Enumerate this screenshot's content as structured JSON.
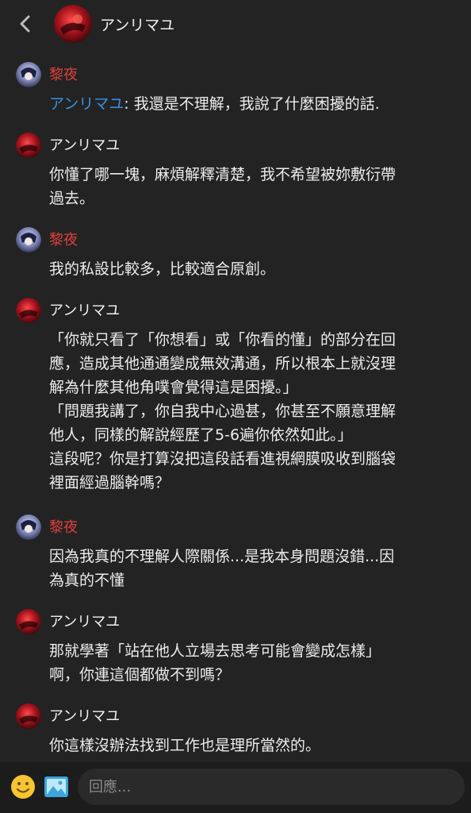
{
  "header": {
    "title": "アンリマユ"
  },
  "messages": [
    {
      "author": "黎夜",
      "mention": "アンリマユ",
      "text": ": 我還是不理解，我說了什麼困擾的話."
    },
    {
      "author": "アンリマユ",
      "lines": [
        "你懂了哪一塊，麻煩解釋清楚，我不希望被妳敷衍帶",
        "過去。"
      ]
    },
    {
      "author": "黎夜",
      "lines": [
        "我的私設比較多，比較適合原創。"
      ]
    },
    {
      "author": "アンリマユ",
      "lines": [
        "「你就只看了「你想看」或「你看的懂」的部分在回",
        "應，造成其他通通變成無效溝通，所以根本上就沒理",
        "解為什麼其他角噗會覺得這是困擾。」",
        "「問題我講了，你自我中心過甚，你甚至不願意理解",
        "他人，同樣的解說經歷了5-6遍你依然如此。」",
        "這段呢？你是打算沒把這段話看進視網膜吸收到腦袋",
        "裡面經過腦幹嗎？"
      ]
    },
    {
      "author": "黎夜",
      "lines": [
        "因為我真的不理解人際關係...是我本身問題沒錯...因",
        "為真的不懂"
      ]
    },
    {
      "author": "アンリマユ",
      "lines": [
        "那就學著「站在他人立場去思考可能會變成怎樣」",
        "啊，你連這個都做不到嗎？"
      ]
    },
    {
      "author": "アンリマユ",
      "lines": [
        "你這樣沒辦法找到工作也是理所當然的。"
      ]
    }
  ],
  "composer": {
    "placeholder": "回應..."
  },
  "colors": {
    "background": "#232323",
    "name_red": "#e0413d",
    "mention_blue": "#3a8fe0"
  },
  "icons": [
    "back-chevron-icon",
    "emoji-icon",
    "image-icon"
  ]
}
